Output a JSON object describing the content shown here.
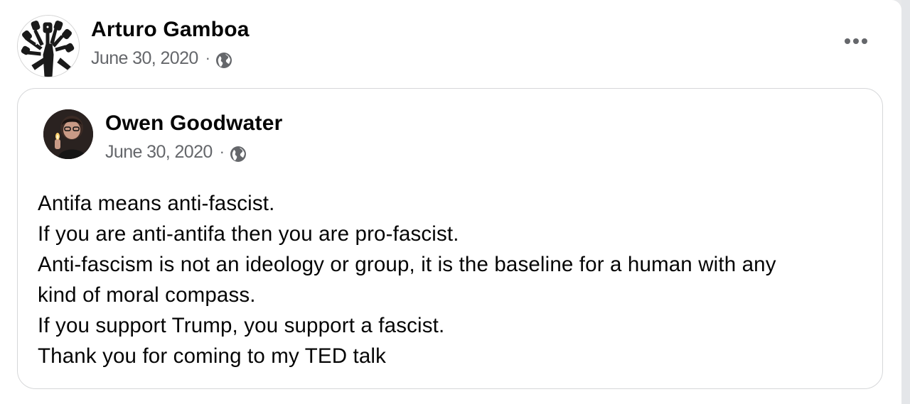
{
  "post": {
    "author": "Arturo Gamboa",
    "date": "June 30, 2020",
    "separator": "·",
    "privacy_icon": "globe-icon",
    "more_icon": "more-horizontal-icon"
  },
  "shared_post": {
    "author": "Owen Goodwater",
    "date": "June 30, 2020",
    "separator": "·",
    "privacy_icon": "globe-icon",
    "body_lines": [
      "Antifa means anti-fascist.",
      "If you are anti-antifa then you are pro-fascist.",
      "Anti-fascism is not an ideology or group, it is the baseline for a human with any",
      "kind of moral compass.",
      "If you support Trump, you support a fascist.",
      "Thank you for coming to my TED talk"
    ]
  },
  "colors": {
    "text_primary": "#050505",
    "text_secondary": "#65676b",
    "border": "#d6d7d9",
    "background": "#ffffff"
  }
}
